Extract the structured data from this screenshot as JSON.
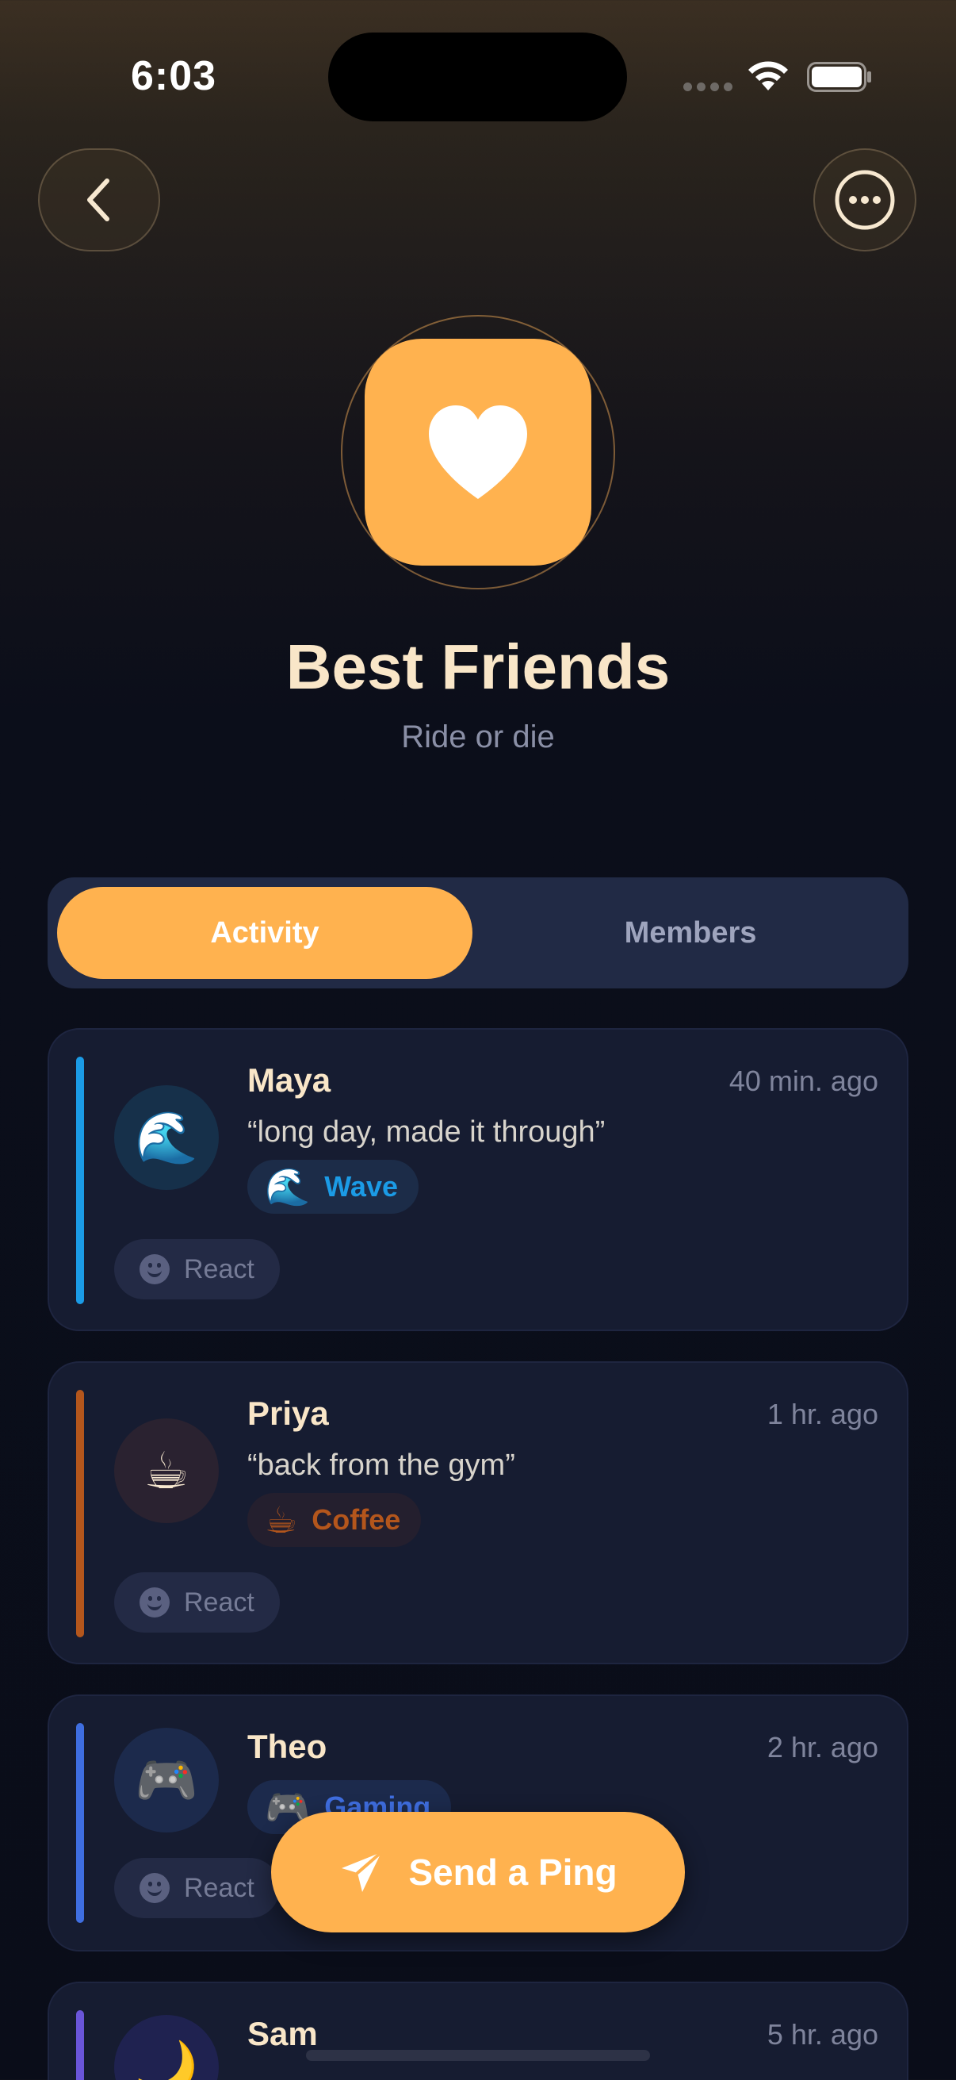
{
  "status_bar": {
    "time": "6:03"
  },
  "header": {
    "back_icon": "chevron-left-icon",
    "more_icon": "ellipsis-circle-icon"
  },
  "group": {
    "icon": "heart-icon",
    "name": "Best Friends",
    "subtitle": "Ride or die",
    "accent_color": "#ffb24f"
  },
  "tabs": [
    {
      "label": "Activity",
      "selected": true
    },
    {
      "label": "Members",
      "selected": false
    }
  ],
  "activity": [
    {
      "name": "Maya",
      "time": "40 min. ago",
      "quote": "“long day, made it through”",
      "avatar": "🌊",
      "chip_emoji": "🌊",
      "chip_label": "Wave",
      "color": "#1b9be6",
      "react_label": "React"
    },
    {
      "name": "Priya",
      "time": "1 hr. ago",
      "quote": "“back from the gym”",
      "avatar": "☕",
      "chip_emoji": "☕",
      "chip_label": "Coffee",
      "color": "#b4561c",
      "react_label": "React"
    },
    {
      "name": "Theo",
      "time": "2 hr. ago",
      "avatar": "🎮",
      "chip_emoji": "🎮",
      "chip_label": "Gaming",
      "color": "#3f6ee0",
      "react_label": "React"
    },
    {
      "name": "Sam",
      "time": "5 hr. ago",
      "avatar": "🌙",
      "chip_emoji": "🌙",
      "color": "#6a55d8"
    }
  ],
  "fab": {
    "label": "Send a Ping",
    "icon": "paper-plane-icon"
  }
}
